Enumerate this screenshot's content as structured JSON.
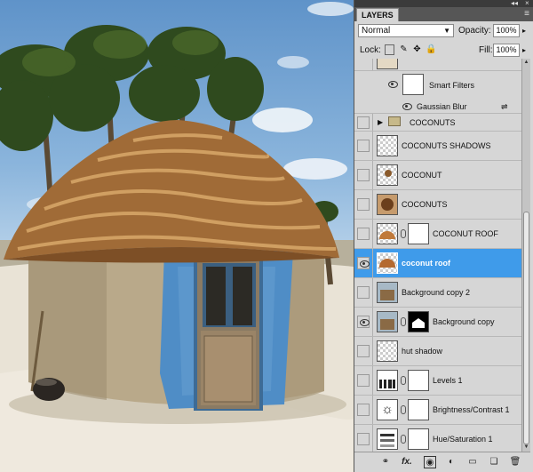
{
  "panel": {
    "tab_label": "LAYERS",
    "menu_icon": "panel-menu-icon",
    "blend_mode": "Normal",
    "opacity_label": "Opacity:",
    "opacity_value": "100%",
    "lock_label": "Lock:",
    "fill_label": "Fill:",
    "fill_value": "100%"
  },
  "layers": [
    {
      "name": "",
      "kind": "partial-top"
    },
    {
      "name": "Smart Filters",
      "kind": "smart-filters"
    },
    {
      "name": "Gaussian Blur",
      "kind": "filter"
    },
    {
      "name": "COCONUTS",
      "kind": "group"
    },
    {
      "name": "COCONUTS SHADOWS",
      "kind": "layer"
    },
    {
      "name": "COCONUT",
      "kind": "layer"
    },
    {
      "name": "COCONUTS",
      "kind": "layer"
    },
    {
      "name": "COCONUT ROOF",
      "kind": "masked"
    },
    {
      "name": "coconut roof",
      "kind": "layer",
      "selected": true
    },
    {
      "name": "Background copy 2",
      "kind": "layer"
    },
    {
      "name": "Background copy",
      "kind": "masked"
    },
    {
      "name": "hut shadow",
      "kind": "layer"
    },
    {
      "name": "Levels 1",
      "kind": "adjustment"
    },
    {
      "name": "Brightness/Contrast 1",
      "kind": "adjustment"
    },
    {
      "name": "Hue/Saturation 1",
      "kind": "adjustment"
    }
  ],
  "colors": {
    "selection": "#3f9bea",
    "panel_bg": "#d6d6d6",
    "sky": "#6a9ccf",
    "sand": "#e9e3d6",
    "door_blue": "#4f8dc6"
  },
  "footer_icons": [
    "link-layers-icon",
    "fx-icon",
    "add-mask-icon",
    "adjustment-layer-icon",
    "new-group-icon",
    "new-layer-icon",
    "trash-icon"
  ]
}
